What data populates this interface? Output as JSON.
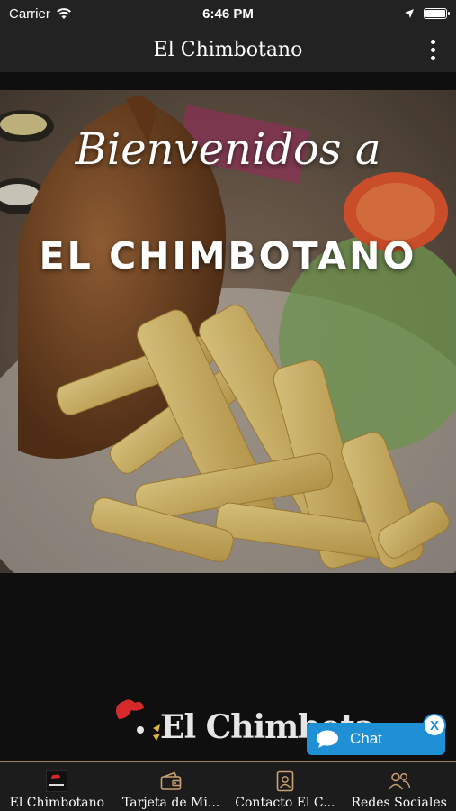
{
  "status_bar": {
    "carrier": "Carrier",
    "time": "6:46 PM"
  },
  "nav": {
    "title": "El Chimbotano",
    "menu_icon": "more-vertical-icon"
  },
  "hero": {
    "script_text": "Bienvenidos a",
    "title": "EL CHIMBOTANO"
  },
  "logo": {
    "text": "El Chimbota"
  },
  "chat": {
    "label": "Chat",
    "close_label": "X",
    "color": "#1f8fd6"
  },
  "tabs": [
    {
      "label": "El Chimbotano",
      "icon": "app-logo-icon"
    },
    {
      "label": "Tarjeta de Mi...",
      "icon": "wallet-icon"
    },
    {
      "label": "Contacto El C...",
      "icon": "contact-card-icon"
    },
    {
      "label": "Redes Sociales",
      "icon": "users-icon"
    }
  ],
  "colors": {
    "bar_background": "#222222",
    "tab_accent": "#a08560"
  }
}
